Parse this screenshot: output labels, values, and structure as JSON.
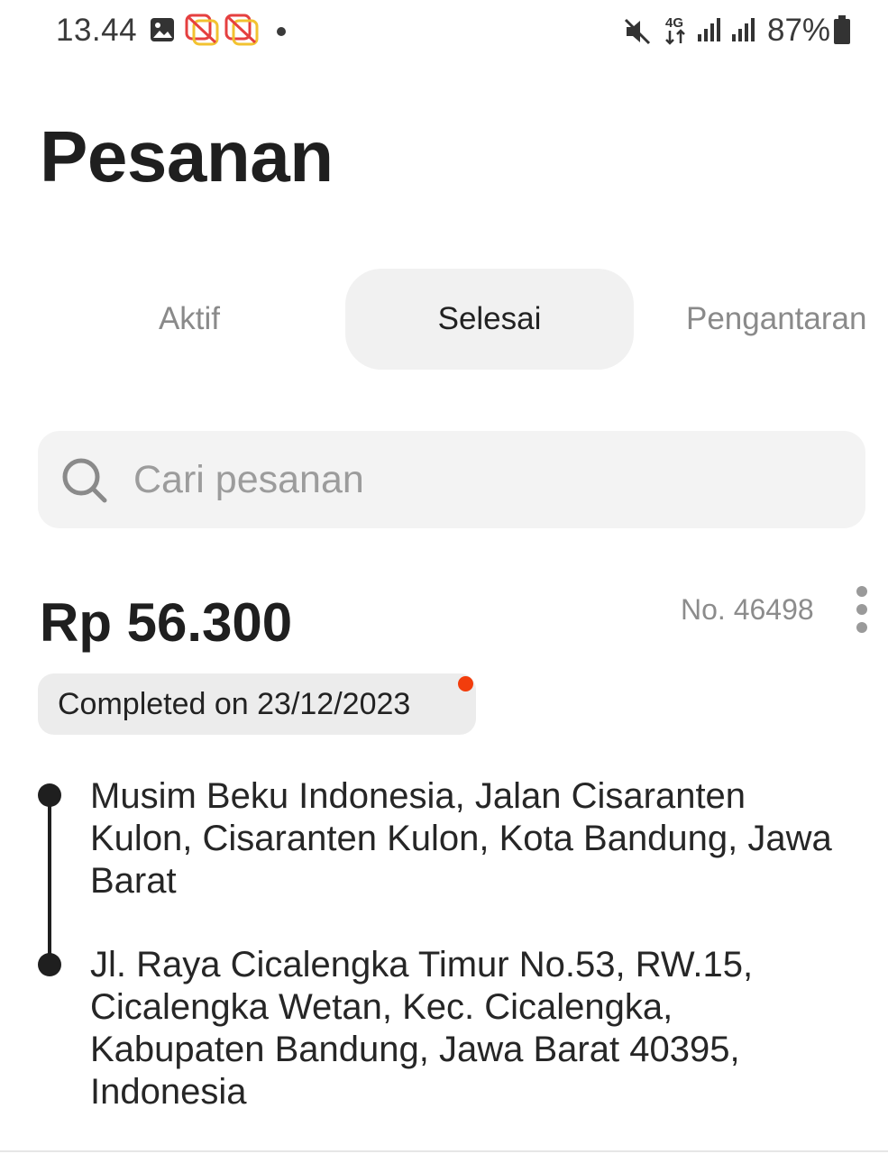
{
  "status_bar": {
    "time": "13.44",
    "icons": [
      "gallery-icon",
      "app-notification-icon",
      "app-notification-icon",
      "mute-icon",
      "4g-icon",
      "signal-icon",
      "signal-icon",
      "battery-icon"
    ],
    "battery_percent": "87%"
  },
  "header": {
    "title": "Pesanan"
  },
  "tabs": [
    {
      "label": "Aktif",
      "active": false
    },
    {
      "label": "Selesai",
      "active": true
    },
    {
      "label": "Pengantaran",
      "active": false
    }
  ],
  "search": {
    "placeholder": "Cari pesanan",
    "value": ""
  },
  "order": {
    "price": "Rp 56.300",
    "number": "No. 46498",
    "status": "Completed on 23/12/2023",
    "origin": "Musim Beku Indonesia, Jalan Cisaranten Kulon, Cisaranten Kulon, Kota Bandung, Jawa Barat",
    "destination": "Jl. Raya Cicalengka Timur No.53, RW.15, Cicalengka Wetan, Kec. Cicalengka, Kabupaten Bandung, Jawa Barat 40395, Indonesia"
  },
  "colors": {
    "notification_dot": "#f23d0c",
    "active_tab_bg": "#f1f1f1",
    "search_bg": "#f3f3f3",
    "badge_bg": "#ececec"
  }
}
